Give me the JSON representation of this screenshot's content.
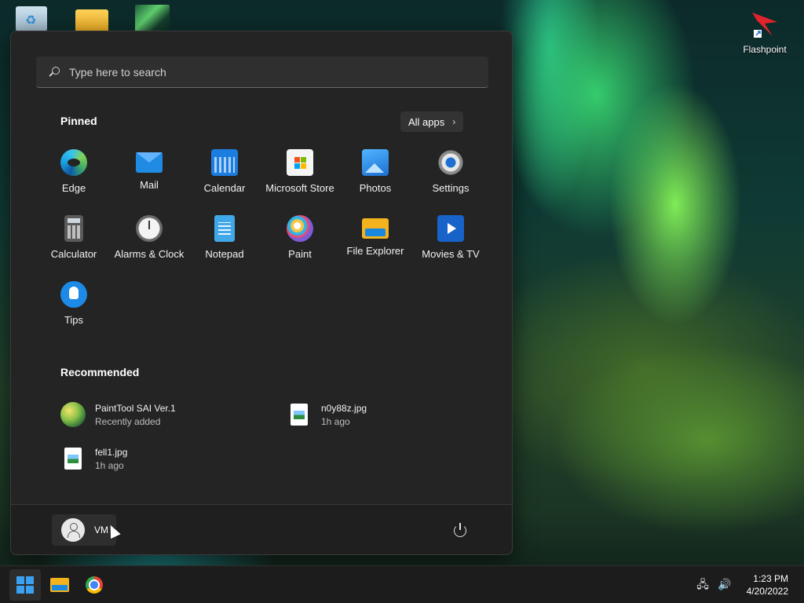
{
  "desktop": {
    "icons": [
      {
        "label": "Flashpoint"
      }
    ]
  },
  "start_menu": {
    "search": {
      "placeholder": "Type here to search"
    },
    "pinned": {
      "title": "Pinned",
      "all_apps_label": "All apps",
      "apps": [
        {
          "label": "Edge",
          "icon": "edge-icon"
        },
        {
          "label": "Mail",
          "icon": "mail-icon"
        },
        {
          "label": "Calendar",
          "icon": "calendar-icon"
        },
        {
          "label": "Microsoft Store",
          "icon": "store-icon"
        },
        {
          "label": "Photos",
          "icon": "photos-icon"
        },
        {
          "label": "Settings",
          "icon": "settings-icon"
        },
        {
          "label": "Calculator",
          "icon": "calculator-icon"
        },
        {
          "label": "Alarms & Clock",
          "icon": "clock-icon"
        },
        {
          "label": "Notepad",
          "icon": "notepad-icon"
        },
        {
          "label": "Paint",
          "icon": "paint-icon"
        },
        {
          "label": "File Explorer",
          "icon": "folder-icon"
        },
        {
          "label": "Movies & TV",
          "icon": "movies-icon"
        },
        {
          "label": "Tips",
          "icon": "tips-icon"
        }
      ]
    },
    "recommended": {
      "title": "Recommended",
      "items": [
        {
          "name": "PaintTool SAI Ver.1",
          "sub": "Recently added"
        },
        {
          "name": "n0y88z.jpg",
          "sub": "1h ago"
        },
        {
          "name": "fell1.jpg",
          "sub": "1h ago"
        }
      ]
    },
    "user": {
      "name": "VM"
    }
  },
  "taskbar": {
    "clock": {
      "time": "1:23 PM",
      "date": "4/20/2022"
    }
  },
  "colors": {
    "accent": "#3aa0f2",
    "menu_bg": "#242424",
    "taskbar_bg": "#1c1c1c"
  }
}
